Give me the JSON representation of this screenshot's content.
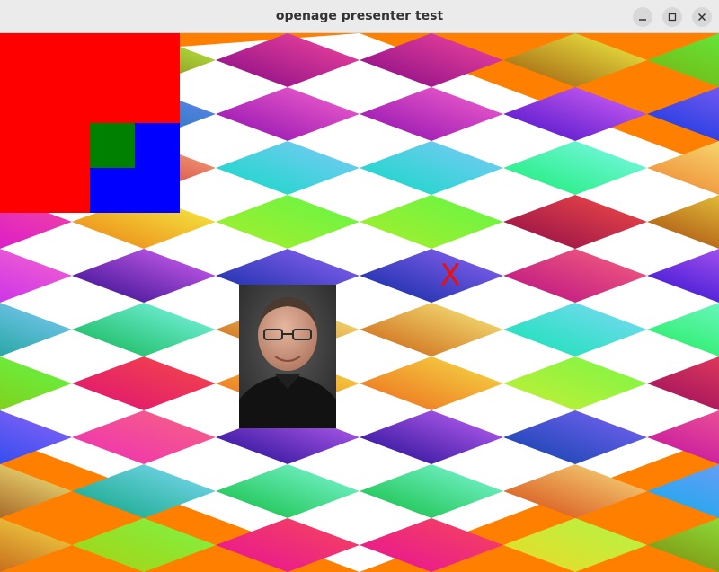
{
  "window": {
    "title": "openage presenter test",
    "controls": {
      "minimize": "minimize-icon",
      "maximize": "maximize-icon",
      "close": "close-icon"
    }
  },
  "scene": {
    "background_color": "#ff8000",
    "marker_text": "X",
    "marker_color": "#e81010",
    "overlay_colors": [
      "#ff0000",
      "#0000ff",
      "#008000"
    ],
    "photo_icon": "portrait-photo"
  }
}
